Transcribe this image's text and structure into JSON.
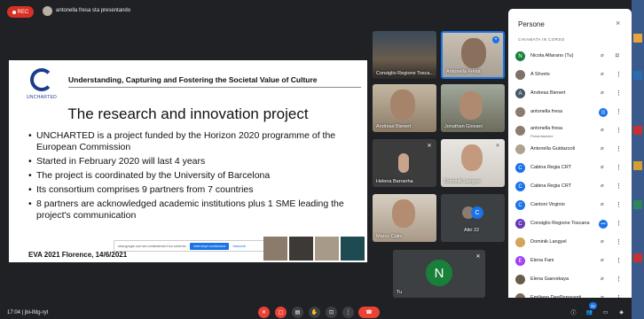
{
  "topbar": {
    "rec_label": "REC",
    "presenting_text": "antonella fresa sta presentando"
  },
  "slide": {
    "logo_text": "UNCHARTED",
    "header": "Understanding, Capturing and Fostering the Societal Value of Culture",
    "title": "The research and innovation project",
    "bullets": [
      "UNCHARTED is a project funded by the Horizon 2020 programme of the European Commission",
      "Started in February 2020 will last 4 years",
      "The project is coordinated by the University of Barcelona",
      "Its consortium comprises 9 partners from 7 countries",
      "8 partners are acknowledged academic institutions plus 1 SME leading the project's communication"
    ],
    "footer": "EVA 2021 Florence, 14/6/2021",
    "popup_text": "www.google.com sta condividendo il tuo schermo.",
    "popup_stop": "Interrompi condivisione",
    "popup_hide": "Nascondi"
  },
  "tiles": {
    "t1": "Consiglio Regione Tosca...",
    "t2": "Antonella Fresa",
    "t3": "Andreas Bienert",
    "t4": "Jonathan Giovani",
    "t5": "Helena Barranha",
    "t6": "Dominik Langyel",
    "t7": "Marco Calis",
    "t8": "Altri 22",
    "t8_avatar": "C",
    "t9_avatar": "N",
    "t9_name": "Tu"
  },
  "panel": {
    "title": "Persone",
    "close": "×",
    "section": "CHIAMATA IN CORSO",
    "people": [
      {
        "name": "Nicola Alfarano (Tu)",
        "initial": "N",
        "color": "#188038",
        "sub": ""
      },
      {
        "name": "A Shvets",
        "initial": "",
        "color": "#7d7169",
        "sub": ""
      },
      {
        "name": "Andreas Bienert",
        "initial": "A",
        "color": "#455a64",
        "sub": ""
      },
      {
        "name": "antonella fresa",
        "initial": "",
        "color": "#8d7b6f",
        "sub": ""
      },
      {
        "name": "antonella fresa",
        "initial": "",
        "color": "#8d7b6f",
        "sub": "Presentazione"
      },
      {
        "name": "Antonella Guidazzoli",
        "initial": "",
        "color": "#b0a28f",
        "sub": ""
      },
      {
        "name": "Cabina Regia CRT",
        "initial": "C",
        "color": "#1a73e8",
        "sub": ""
      },
      {
        "name": "Cabina Regia CRT",
        "initial": "C",
        "color": "#1a73e8",
        "sub": ""
      },
      {
        "name": "Cantoni Virginio",
        "initial": "C",
        "color": "#1a73e8",
        "sub": ""
      },
      {
        "name": "Consiglio Regione Toscana",
        "initial": "C",
        "color": "#673ab7",
        "sub": ""
      },
      {
        "name": "Dominik Langyel",
        "initial": "",
        "color": "#d4a35c",
        "sub": ""
      },
      {
        "name": "Elena Fani",
        "initial": "E",
        "color": "#a142f4",
        "sub": ""
      },
      {
        "name": "Elena Gaevskaya",
        "initial": "",
        "color": "#6b5b4d",
        "sub": ""
      },
      {
        "name": "Emiliano Degl'Innocenti",
        "initial": "",
        "color": "#7a6a5a",
        "sub": ""
      }
    ]
  },
  "bottombar": {
    "meeting_code": "17:04 | jbi-ifdg-ryt",
    "participants_badge": "31"
  }
}
